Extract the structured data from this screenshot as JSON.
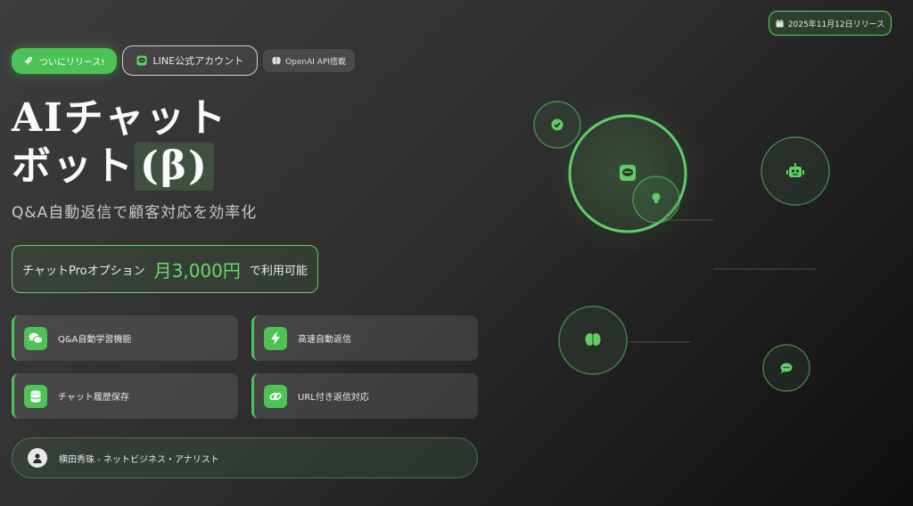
{
  "header": {
    "release_date": "2025年11月12日リリース",
    "calendar_icon": "calendar-icon"
  },
  "badges": {
    "release": "ついにリリース!",
    "release_icon": "rocket-icon",
    "line_account": "LINE公式アカウント",
    "line_icon": "line-icon",
    "openai": "OpenAI API搭載",
    "openai_icon": "brain-icon"
  },
  "hero": {
    "title_line1": "AIチャット",
    "title_line2_prefix": "ボット",
    "title_beta": "(β)",
    "subtitle": "Q&A自動返信で顧客対応を効率化"
  },
  "pricing": {
    "prefix": "チャットProオプション",
    "amount": "月3,000円",
    "suffix": "で利用可能"
  },
  "features": [
    {
      "label": "Q&A自動学習機能",
      "icon": "chat-bubbles-icon"
    },
    {
      "label": "高速自動返信",
      "icon": "lightning-icon"
    },
    {
      "label": "チャット履歴保存",
      "icon": "database-icon"
    },
    {
      "label": "URL付き返信対応",
      "icon": "link-icon"
    }
  ],
  "author": {
    "text": "横田秀珠 - ネットビジネス・アナリスト",
    "icon": "user-icon"
  },
  "graphic": {
    "nodes": [
      "check-icon",
      "line-icon",
      "lightbulb-icon",
      "robot-icon",
      "brain-icon",
      "comment-icon"
    ]
  },
  "colors": {
    "accent": "#4cc354",
    "accent_light": "#6bd86f",
    "background_dark": "#1a1a1a"
  }
}
